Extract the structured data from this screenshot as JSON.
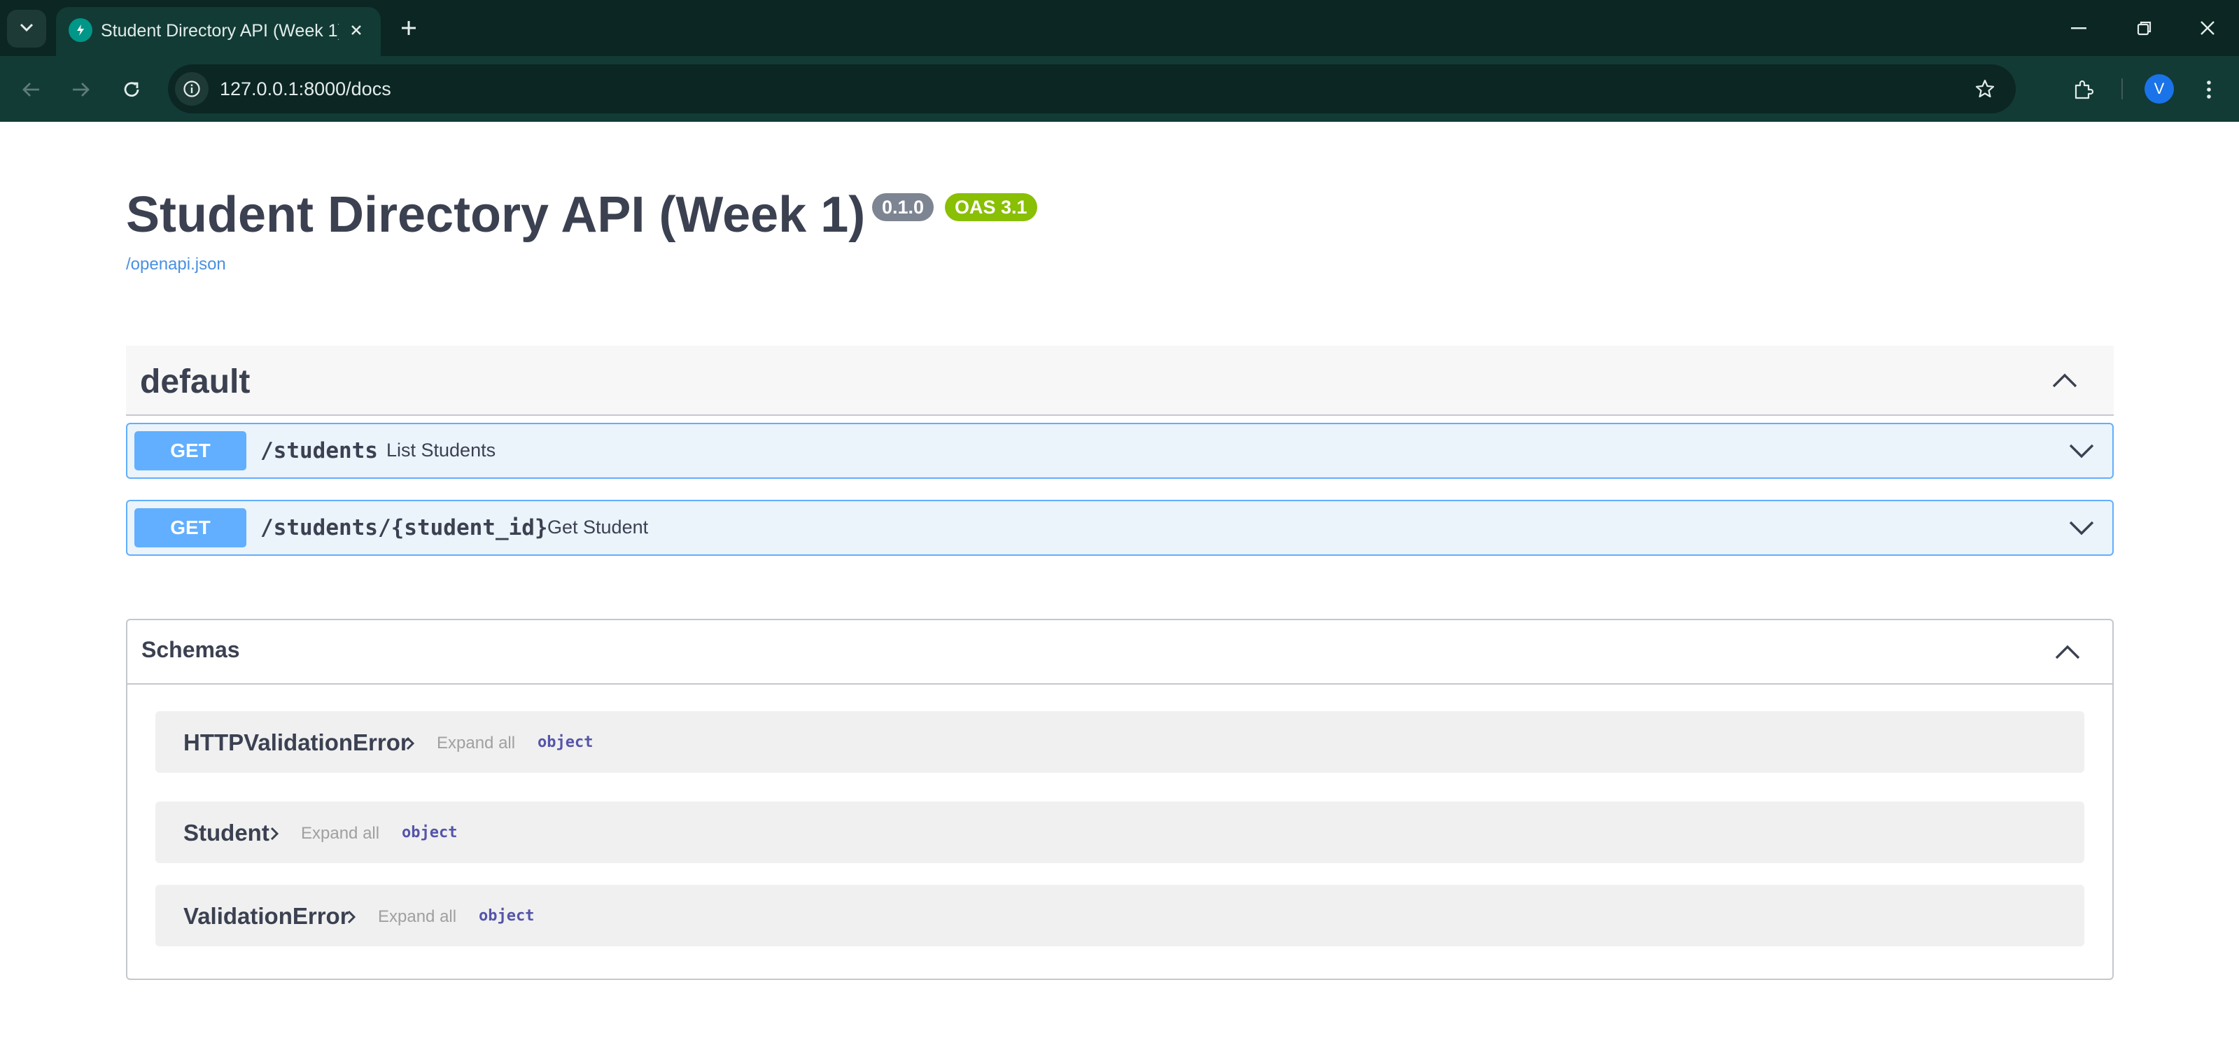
{
  "browser": {
    "tab_title": "Student Directory API (Week 1)",
    "url": "127.0.0.1:8000/docs",
    "profile_initial": "V",
    "icons": [
      "tab-search-icon",
      "favicon-icon",
      "close-icon",
      "plus-icon",
      "minimize-icon",
      "restore-icon",
      "window-close-icon",
      "back-icon",
      "forward-icon",
      "reload-icon",
      "site-info-icon",
      "bookmark-star-icon",
      "extensions-icon",
      "menu-icon"
    ]
  },
  "info": {
    "title": "Student Directory API (Week 1)",
    "version": "0.1.0",
    "oas": "OAS 3.1",
    "spec_link": "/openapi.json"
  },
  "tag": {
    "name": "default",
    "operations": [
      {
        "method": "GET",
        "path": "/students",
        "summary": "List Students"
      },
      {
        "method": "GET",
        "path": "/students/{student_id}",
        "summary": "Get Student"
      }
    ]
  },
  "schemas": {
    "title": "Schemas",
    "items": [
      {
        "name": "HTTPValidationError",
        "expand_label": "Expand all",
        "type": "object"
      },
      {
        "name": "Student",
        "expand_label": "Expand all",
        "type": "object"
      },
      {
        "name": "ValidationError",
        "expand_label": "Expand all",
        "type": "object"
      }
    ]
  },
  "colors": {
    "get_method": "#61affe",
    "get_background": "#ebf3fb",
    "title_text": "#3b4151",
    "version_badge": "#7d8492",
    "oas_badge": "#89bf04",
    "link": "#4990e2",
    "browser_frame": "#0b2623",
    "browser_toolbar": "#123b36"
  }
}
